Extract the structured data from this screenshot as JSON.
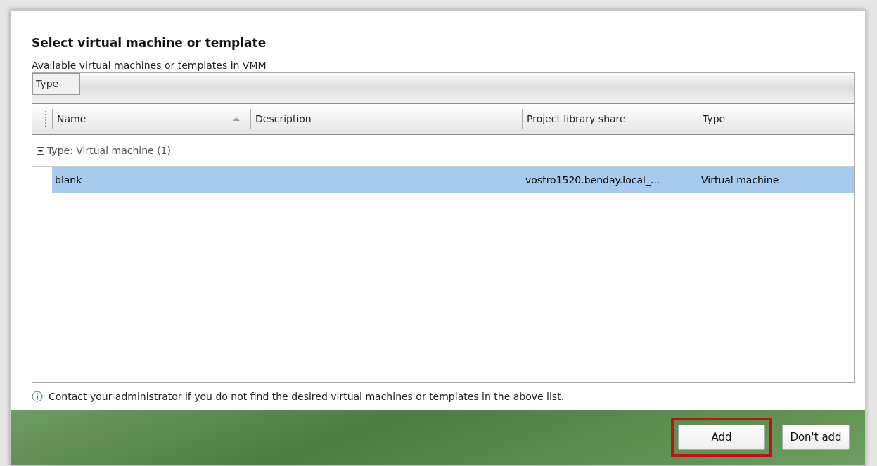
{
  "dialog": {
    "title": "Select virtual machine or template",
    "subtitle": "Available virtual machines or templates in VMM"
  },
  "group_panel": {
    "chips": [
      "Type"
    ]
  },
  "table": {
    "columns": [
      {
        "label": "Name",
        "sorted": true
      },
      {
        "label": "Description",
        "sorted": false
      },
      {
        "label": "Project library share",
        "sorted": false
      },
      {
        "label": "Type",
        "sorted": false
      }
    ],
    "groups": [
      {
        "label": "Type: Virtual machine (1)",
        "expanded": true,
        "rows": [
          {
            "cells": [
              "blank",
              "",
              "vostro1520.benday.local_...",
              "Virtual machine"
            ],
            "selected": true
          }
        ]
      }
    ]
  },
  "info": "Contact your administrator if you do not find the desired virtual machines or templates in the above list.",
  "buttons": [
    {
      "label": "Add",
      "highlighted": true
    },
    {
      "label": "Don't add",
      "highlighted": false
    }
  ]
}
